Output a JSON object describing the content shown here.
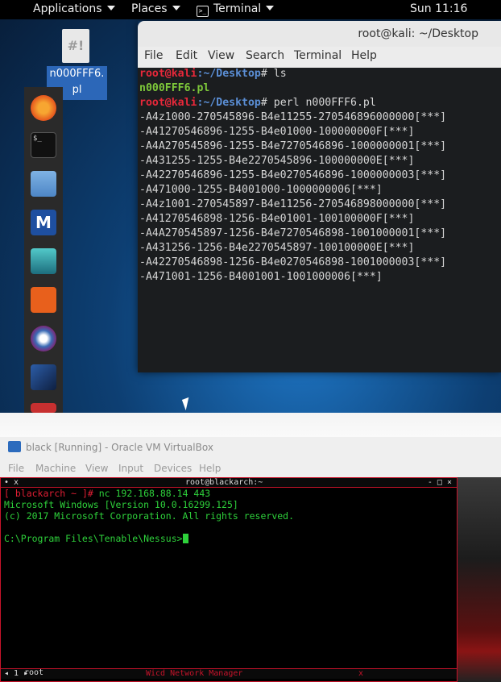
{
  "kali": {
    "topbar": {
      "applications": "Applications",
      "places": "Places",
      "terminal": "Terminal",
      "clock": "Sun 11:16"
    },
    "desktop_icon": {
      "glyph": "#!",
      "label": "n000FFF6.\npl"
    },
    "dock_icons": [
      "firefox-icon",
      "terminal-icon",
      "files-icon",
      "metasploit-icon",
      "armitage-icon",
      "burpsuite-icon",
      "maltego-icon",
      "beef-icon"
    ],
    "window": {
      "title": "root@kali: ~/Desktop",
      "menu": [
        "File",
        "Edit",
        "View",
        "Search",
        "Terminal",
        "Help"
      ],
      "prompt_user": "root@kali",
      "prompt_path": ":~/Desktop",
      "prompt_symbol": "# ",
      "cmd1": "ls",
      "ls_output": "n000FFF6.pl",
      "cmd2": "perl n000FFF6.pl",
      "output": [
        "-A4z1000-270545896-B4e11255-270546896000000[***]",
        "-A41270546896-1255-B4e01000-100000000F[***]",
        "-A4A270545896-1255-B4e7270546896-1000000001[***]",
        "-A431255-1255-B4e2270545896-100000000E[***]",
        "-A42270546896-1255-B4e0270546896-1000000003[***]",
        "-A471000-1255-B4001000-1000000006[***]",
        "-A4z1001-270545897-B4e11256-270546898000000[***]",
        "-A41270546898-1256-B4e01001-100100000F[***]",
        "-A4A270545897-1256-B4e7270546898-1001000001[***]",
        "-A431256-1256-B4e2270545897-100100000E[***]",
        "-A42270546898-1256-B4e0270546898-1001000003[***]",
        "-A471001-1256-B4001001-1001000006[***]"
      ]
    }
  },
  "vbox": {
    "title": "black [Running] - Oracle VM VirtualBox",
    "menu": [
      "File",
      "Machine",
      "View",
      "Input",
      "Devices",
      "Help"
    ],
    "terminal": {
      "title": "root@blackarch:~",
      "top_left": "• x",
      "top_right": "- □ ×",
      "prompt_open": "[ ",
      "prompt_host": "blackarch",
      "prompt_rest": " ~ ]# ",
      "command": "nc 192.168.88.14 443",
      "line2": "Microsoft Windows [Version 10.0.16299.125]",
      "line3": "(c) 2017 Microsoft Corporation. All rights reserved.",
      "line5": "C:\\Program Files\\Tenable\\Nessus>",
      "status_left": "◂ 1 ▸",
      "status_center": "Wicd Network Manager",
      "status_x": "x"
    },
    "side_label": "root"
  },
  "colors": {
    "kali_prompt": "#e8283a",
    "kali_path": "#5b8fd6",
    "file_green": "#7ec93a",
    "blackarch_green": "#2ed13b",
    "blackarch_red": "#c7132a"
  }
}
